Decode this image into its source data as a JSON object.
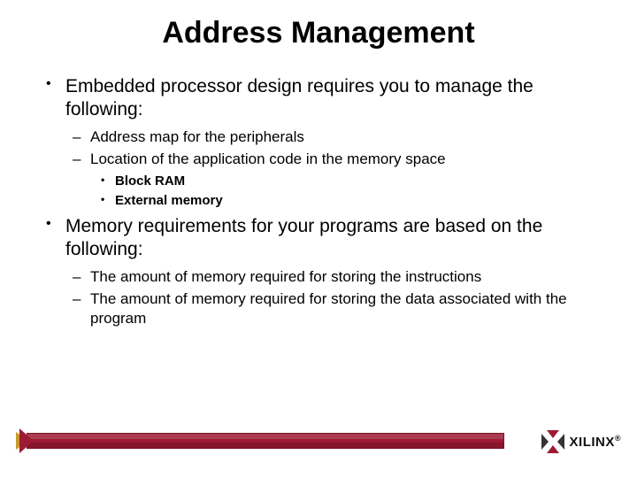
{
  "title": "Address Management",
  "bullets": [
    {
      "text": "Embedded processor design requires you to manage the following:",
      "children": [
        {
          "text": "Address map for the peripherals"
        },
        {
          "text": "Location of the application code in the memory space",
          "children": [
            {
              "text": "Block RAM"
            },
            {
              "text": "External memory"
            }
          ]
        }
      ]
    },
    {
      "text": "Memory requirements for your programs are based on the following:",
      "children": [
        {
          "text": "The amount of memory required for storing the instructions"
        },
        {
          "text": "The amount of memory required for storing the data associated with the program"
        }
      ]
    }
  ],
  "footer": {
    "brand": "XILINX",
    "reg": "®",
    "bar_color": "#9d1b33"
  }
}
